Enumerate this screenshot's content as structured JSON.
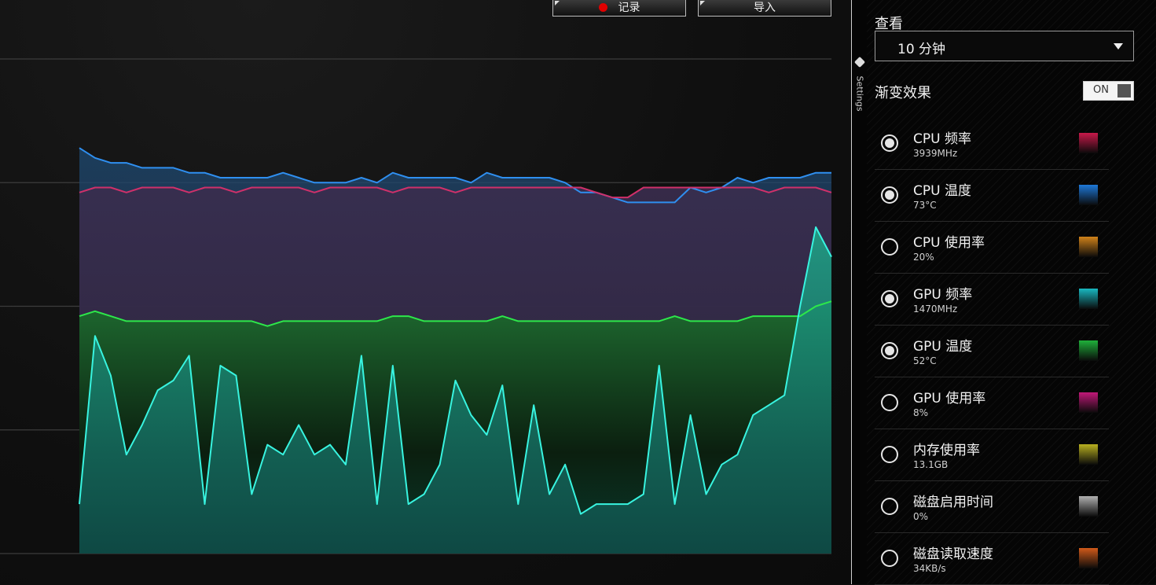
{
  "toolbar": {
    "record_label": "记录",
    "import_label": "导入"
  },
  "settings_tab": {
    "label": "Settings"
  },
  "panel": {
    "view_label": "查看",
    "view_value": "10 分钟",
    "gradient_label": "渐变效果",
    "gradient_state": "ON"
  },
  "metrics": [
    {
      "name": "CPU 频率",
      "value": "3939MHz",
      "selected": true,
      "color": "#c8194a"
    },
    {
      "name": "CPU 温度",
      "value": "73°C",
      "selected": true,
      "color": "#1e78d8"
    },
    {
      "name": "CPU 使用率",
      "value": "20%",
      "selected": false,
      "color": "#d0821a"
    },
    {
      "name": "GPU 频率",
      "value": "1470MHz",
      "selected": true,
      "color": "#19b8c0"
    },
    {
      "name": "GPU 温度",
      "value": "52°C",
      "selected": true,
      "color": "#1fb03a"
    },
    {
      "name": "GPU 使用率",
      "value": "8%",
      "selected": false,
      "color": "#c01878"
    },
    {
      "name": "内存使用率",
      "value": "13.1GB",
      "selected": false,
      "color": "#b8b020"
    },
    {
      "name": "磁盘启用时间",
      "value": "0%",
      "selected": false,
      "color": "#b0b0b0"
    },
    {
      "name": "磁盘读取速度",
      "value": "34KB/s",
      "selected": false,
      "color": "#d05a1a"
    }
  ],
  "chart_data": {
    "type": "line",
    "title": "",
    "xlabel": "",
    "ylabel": "",
    "ylim": [
      0,
      100
    ],
    "grid": true,
    "series": [
      {
        "name": "CPU 温度",
        "color": "#2f8ff0",
        "values": [
          82,
          80,
          79,
          79,
          78,
          78,
          78,
          77,
          77,
          76,
          76,
          76,
          76,
          77,
          76,
          75,
          75,
          75,
          76,
          75,
          77,
          76,
          76,
          76,
          76,
          75,
          77,
          76,
          76,
          76,
          76,
          75,
          73,
          73,
          72,
          71,
          71,
          71,
          71,
          74,
          73,
          74,
          76,
          75,
          76,
          76,
          76,
          77,
          77
        ]
      },
      {
        "name": "CPU 频率",
        "color": "#d0306a",
        "values": [
          73,
          74,
          74,
          73,
          74,
          74,
          74,
          73,
          74,
          74,
          73,
          74,
          74,
          74,
          74,
          73,
          74,
          74,
          74,
          74,
          73,
          74,
          74,
          74,
          73,
          74,
          74,
          74,
          74,
          74,
          74,
          74,
          74,
          73,
          72,
          72,
          74,
          74,
          74,
          74,
          74,
          74,
          74,
          74,
          73,
          74,
          74,
          74,
          73
        ]
      },
      {
        "name": "GPU 温度",
        "color": "#2de84a",
        "values": [
          48,
          49,
          48,
          47,
          47,
          47,
          47,
          47,
          47,
          47,
          47,
          47,
          46,
          47,
          47,
          47,
          47,
          47,
          47,
          47,
          48,
          48,
          47,
          47,
          47,
          47,
          47,
          48,
          47,
          47,
          47,
          47,
          47,
          47,
          47,
          47,
          47,
          47,
          48,
          47,
          47,
          47,
          47,
          48,
          48,
          48,
          48,
          50,
          51
        ]
      },
      {
        "name": "GPU 频率",
        "color": "#38f4e0",
        "values": [
          10,
          44,
          36,
          20,
          26,
          33,
          35,
          40,
          10,
          38,
          36,
          12,
          22,
          20,
          26,
          20,
          22,
          18,
          40,
          10,
          38,
          10,
          12,
          18,
          35,
          28,
          24,
          34,
          10,
          30,
          12,
          18,
          8,
          10,
          10,
          10,
          12,
          38,
          10,
          28,
          12,
          18,
          20,
          28,
          30,
          32,
          50,
          66,
          60
        ]
      }
    ]
  }
}
